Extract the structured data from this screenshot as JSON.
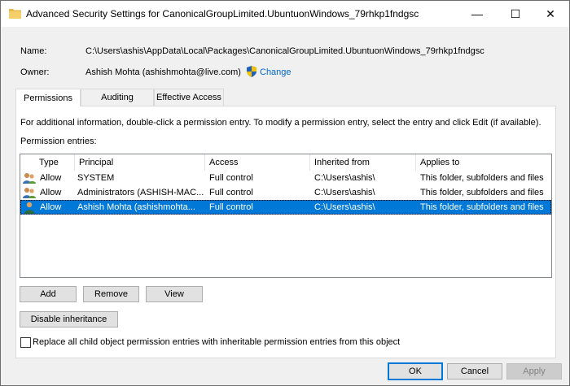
{
  "window": {
    "title": "Advanced Security Settings for CanonicalGroupLimited.UbuntuonWindows_79rhkp1fndgsc",
    "minimize_glyph": "—",
    "maximize_glyph": "☐",
    "close_glyph": "✕"
  },
  "name": {
    "label": "Name:",
    "value": "C:\\Users\\ashis\\AppData\\Local\\Packages\\CanonicalGroupLimited.UbuntuonWindows_79rhkp1fndgsc"
  },
  "owner": {
    "label": "Owner:",
    "value": "Ashish Mohta (ashishmohta@live.com)",
    "change_label": "Change",
    "shield_icon": "uac-shield-icon"
  },
  "tabs": [
    {
      "label": "Permissions",
      "active": true
    },
    {
      "label": "Auditing",
      "active": false
    },
    {
      "label": "Effective Access",
      "active": false
    }
  ],
  "info_text": "For additional information, double-click a permission entry. To modify a permission entry, select the entry and click Edit (if available).",
  "entries_label": "Permission entries:",
  "columns": [
    "Type",
    "Principal",
    "Access",
    "Inherited from",
    "Applies to"
  ],
  "entries": [
    {
      "type": "Allow",
      "principal": "SYSTEM",
      "access": "Full control",
      "inherited_from": "C:\\Users\\ashis\\",
      "applies_to": "This folder, subfolders and files",
      "icon": "users-group-icon",
      "selected": false
    },
    {
      "type": "Allow",
      "principal": "Administrators (ASHISH-MAC...",
      "access": "Full control",
      "inherited_from": "C:\\Users\\ashis\\",
      "applies_to": "This folder, subfolders and files",
      "icon": "users-group-icon",
      "selected": false
    },
    {
      "type": "Allow",
      "principal": "Ashish Mohta (ashishmohta...",
      "access": "Full control",
      "inherited_from": "C:\\Users\\ashis\\",
      "applies_to": "This folder, subfolders and files",
      "icon": "user-icon",
      "selected": true
    }
  ],
  "buttons": {
    "add": "Add",
    "remove": "Remove",
    "view": "View",
    "disable_inheritance": "Disable inheritance",
    "ok": "OK",
    "cancel": "Cancel",
    "apply": "Apply"
  },
  "replace_checkbox": {
    "label": "Replace all child object permission entries with inheritable permission entries from this object",
    "checked": false
  },
  "colors": {
    "selection": "#0078d7",
    "link": "#0066cc",
    "folder": "#e8b84b"
  }
}
